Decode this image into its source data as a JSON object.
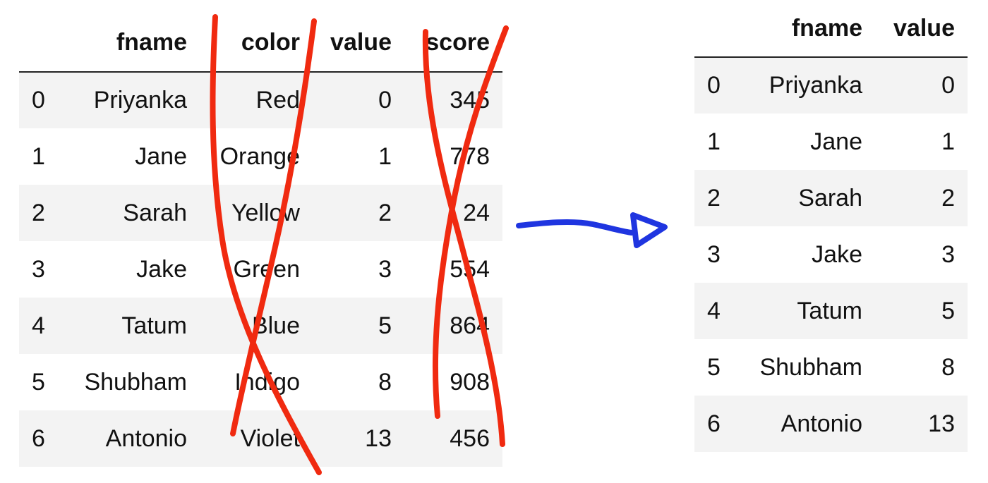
{
  "left_table": {
    "columns": [
      "fname",
      "color",
      "value",
      "score"
    ],
    "rows": [
      {
        "index": "0",
        "fname": "Priyanka",
        "color": "Red",
        "value": "0",
        "score": "345"
      },
      {
        "index": "1",
        "fname": "Jane",
        "color": "Orange",
        "value": "1",
        "score": "778"
      },
      {
        "index": "2",
        "fname": "Sarah",
        "color": "Yellow",
        "value": "2",
        "score": "24"
      },
      {
        "index": "3",
        "fname": "Jake",
        "color": "Green",
        "value": "3",
        "score": "554"
      },
      {
        "index": "4",
        "fname": "Tatum",
        "color": "Blue",
        "value": "5",
        "score": "864"
      },
      {
        "index": "5",
        "fname": "Shubham",
        "color": "Indigo",
        "value": "8",
        "score": "908"
      },
      {
        "index": "6",
        "fname": "Antonio",
        "color": "Violet",
        "value": "13",
        "score": "456"
      }
    ]
  },
  "right_table": {
    "columns": [
      "fname",
      "value"
    ],
    "rows": [
      {
        "index": "0",
        "fname": "Priyanka",
        "value": "0"
      },
      {
        "index": "1",
        "fname": "Jane",
        "value": "1"
      },
      {
        "index": "2",
        "fname": "Sarah",
        "value": "2"
      },
      {
        "index": "3",
        "fname": "Jake",
        "value": "3"
      },
      {
        "index": "4",
        "fname": "Tatum",
        "value": "5"
      },
      {
        "index": "5",
        "fname": "Shubham",
        "value": "8"
      },
      {
        "index": "6",
        "fname": "Antonio",
        "value": "13"
      }
    ]
  },
  "annotations": {
    "cross_color": "#f02a10",
    "arrow_color": "#1f35e0",
    "crossed_out_columns": [
      "color",
      "score"
    ],
    "arrow_icon": "hand-drawn-right-arrow-icon",
    "cross_icon": "hand-drawn-x-mark-icon"
  }
}
